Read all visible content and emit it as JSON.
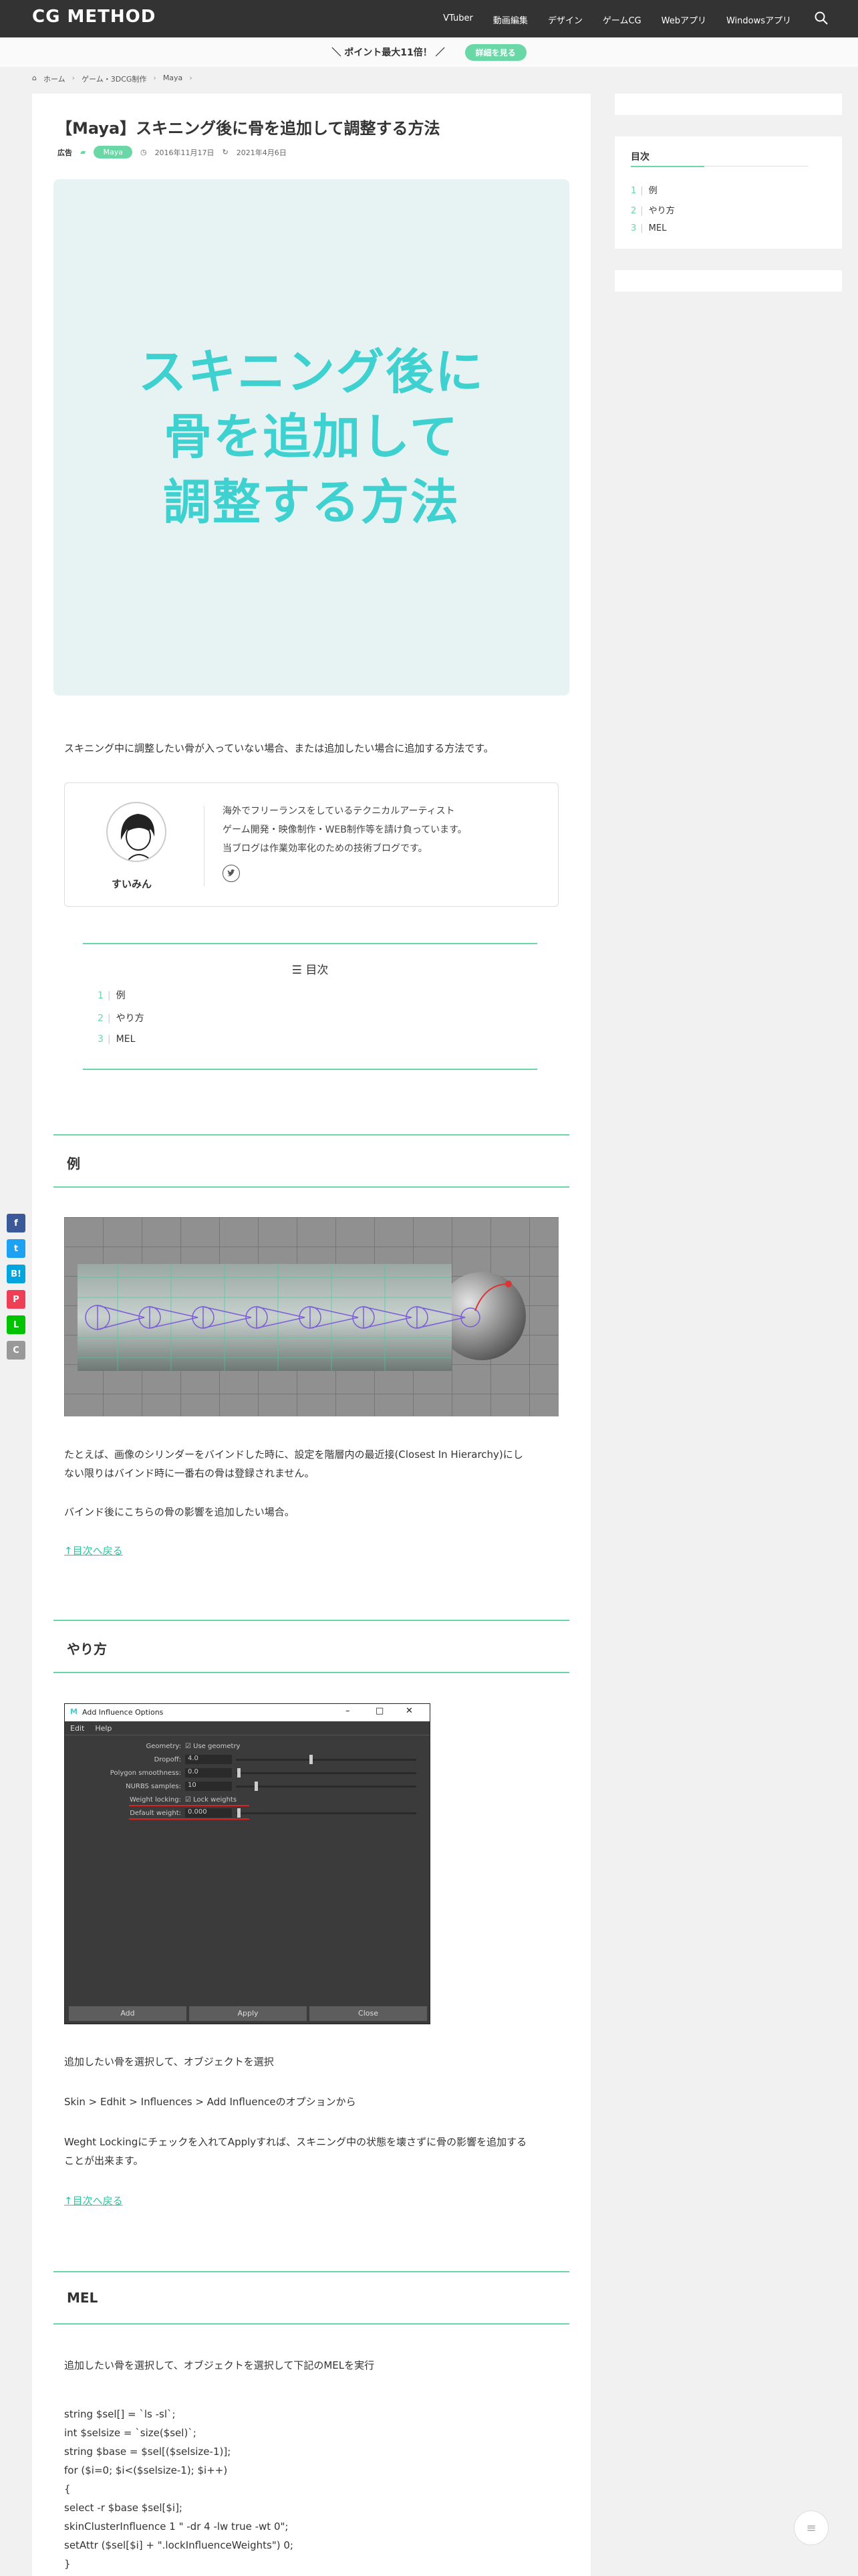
{
  "header": {
    "logo": "CG METHOD",
    "nav": [
      "VTuber",
      "動画編集",
      "デザイン",
      "ゲームCG",
      "Webアプリ",
      "Windowsアプリ"
    ]
  },
  "notice": {
    "text": "＼ ポイント最大11倍！ ／",
    "button": "詳細を見る"
  },
  "breadcrumb": [
    "ホーム",
    "ゲーム・3DCG制作",
    "Maya"
  ],
  "article": {
    "title": "【Maya】スキニング後に骨を追加して調整する方法",
    "ad_label": "広告",
    "tag": "Maya",
    "published": "2016年11月17日",
    "updated": "2021年4月6日",
    "eyecatch_lines": [
      "スキニング後に",
      "骨を追加して",
      "調整する方法"
    ],
    "intro": "スキニング中に調整したい骨が入っていない場合、または追加したい場合に追加する方法です。",
    "profile": {
      "name": "すいみん",
      "bio": [
        "海外でフリーランスをしているテクニカルアーティスト",
        "ゲーム開発・映像制作・WEB制作等を請け負っています。",
        "当ブログは作業効率化のための技術ブログです。"
      ]
    },
    "toc": {
      "title": "目次",
      "items": [
        {
          "num": "1",
          "label": "例"
        },
        {
          "num": "2",
          "label": "やり方"
        },
        {
          "num": "3",
          "label": "MEL"
        }
      ]
    },
    "sections": {
      "example": {
        "heading": "例",
        "p1a": "たとえば、画像のシリンダーをバインドした時に、設定を階層内の最近接(Closest In Hierarchy)にし",
        "p1b": "ない限りはバインド時に一番右の骨は登録されません。",
        "p2": "バインド後にこちらの骨の影響を追加したい場合。",
        "back": "↑目次へ戻る"
      },
      "howto": {
        "heading": "やり方",
        "dialog": {
          "title": "Add Influence Options",
          "menu": [
            "Edit",
            "Help"
          ],
          "rows": [
            {
              "label": "Geometry:",
              "value": "Use geometry"
            },
            {
              "label": "Dropoff:",
              "value": "4.0"
            },
            {
              "label": "Polygon smoothness:",
              "value": "0.0"
            },
            {
              "label": "NURBS samples:",
              "value": "10"
            },
            {
              "label": "Weight locking:",
              "value": "Lock weights"
            },
            {
              "label": "Default weight:",
              "value": "0.000"
            }
          ],
          "buttons": [
            "Add",
            "Apply",
            "Close"
          ]
        },
        "p1": "追加したい骨を選択して、オブジェクトを選択",
        "p2": "Skin > Edhit > Influences > Add Influenceのオプションから",
        "p3a": "Weght Lockingにチェックを入れてApplyすれば、スキニング中の状態を壊さずに骨の影響を追加する",
        "p3b": "ことが出来ます。",
        "back": "↑目次へ戻る"
      },
      "mel": {
        "heading": "MEL",
        "p1": "追加したい骨を選択して、オブジェクトを選択して下記のMELを実行",
        "code": "string $sel[] = `ls -sl`;\nint $selsize = `size($sel)`;\nstring $base = $sel[($selsize-1)];\nfor ($i=0; $i<($selsize-1); $i++)\n{\nselect -r $base $sel[$i];\nskinClusterInfluence 1 \" -dr 4 -lw true -wt 0\";\nsetAttr ($sel[$i] + \".lockInfluenceWeights\") 0;\n}"
      }
    }
  },
  "sidebar": {
    "toc_title": "目次",
    "items": [
      {
        "num": "1",
        "label": "例"
      },
      {
        "num": "2",
        "label": "やり方"
      },
      {
        "num": "3",
        "label": "MEL"
      }
    ]
  },
  "share": [
    {
      "label": "f",
      "color": "#3b5998"
    },
    {
      "label": "t",
      "color": "#1da1f2"
    },
    {
      "label": "B!",
      "color": "#00a4de"
    },
    {
      "label": "P",
      "color": "#ef3f56"
    },
    {
      "label": "L",
      "color": "#00c300"
    },
    {
      "label": "C",
      "color": "#999999"
    }
  ],
  "colors": {
    "accent": "#6ad7a7",
    "eyecatch_text": "#3fd0d0",
    "header": "#333333"
  }
}
